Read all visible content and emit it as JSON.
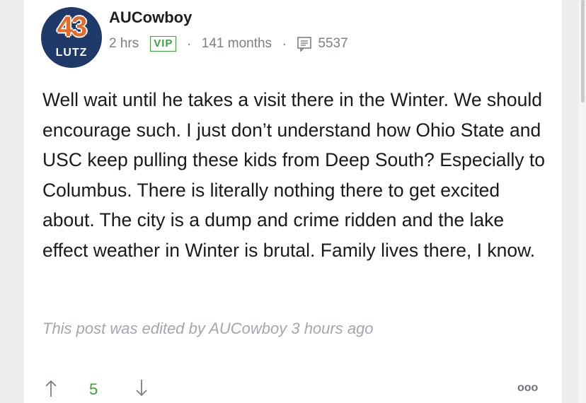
{
  "post": {
    "avatar": {
      "number": "43",
      "name": "LUTZ"
    },
    "author": "AUCowboy",
    "time": "2 hrs",
    "badge": "VIP",
    "tenure": "141 months",
    "post_count": "5537",
    "body": "Well wait until he takes a visit there in the Winter. We should encourage such. I just don’t understand how Ohio State and USC keep pulling these kids from Deep South? Especially to Columbus. There is literally nothing there to get excited about. The city is a dump and crime ridden and the lake effect weather in Winter is brutal. Family lives there, I know.",
    "edited_note": "This post was edited by AUCowboy 3 hours ago",
    "votes": "5",
    "more_label": "ooo"
  },
  "colors": {
    "accent_green": "#3aa53a",
    "avatar_navy": "#1f3a68",
    "avatar_orange": "#e66a2c",
    "meta_gray": "#7a7f86"
  },
  "icons": [
    "posts-icon",
    "upvote-arrow-icon",
    "downvote-arrow-icon",
    "more-options-icon"
  ]
}
